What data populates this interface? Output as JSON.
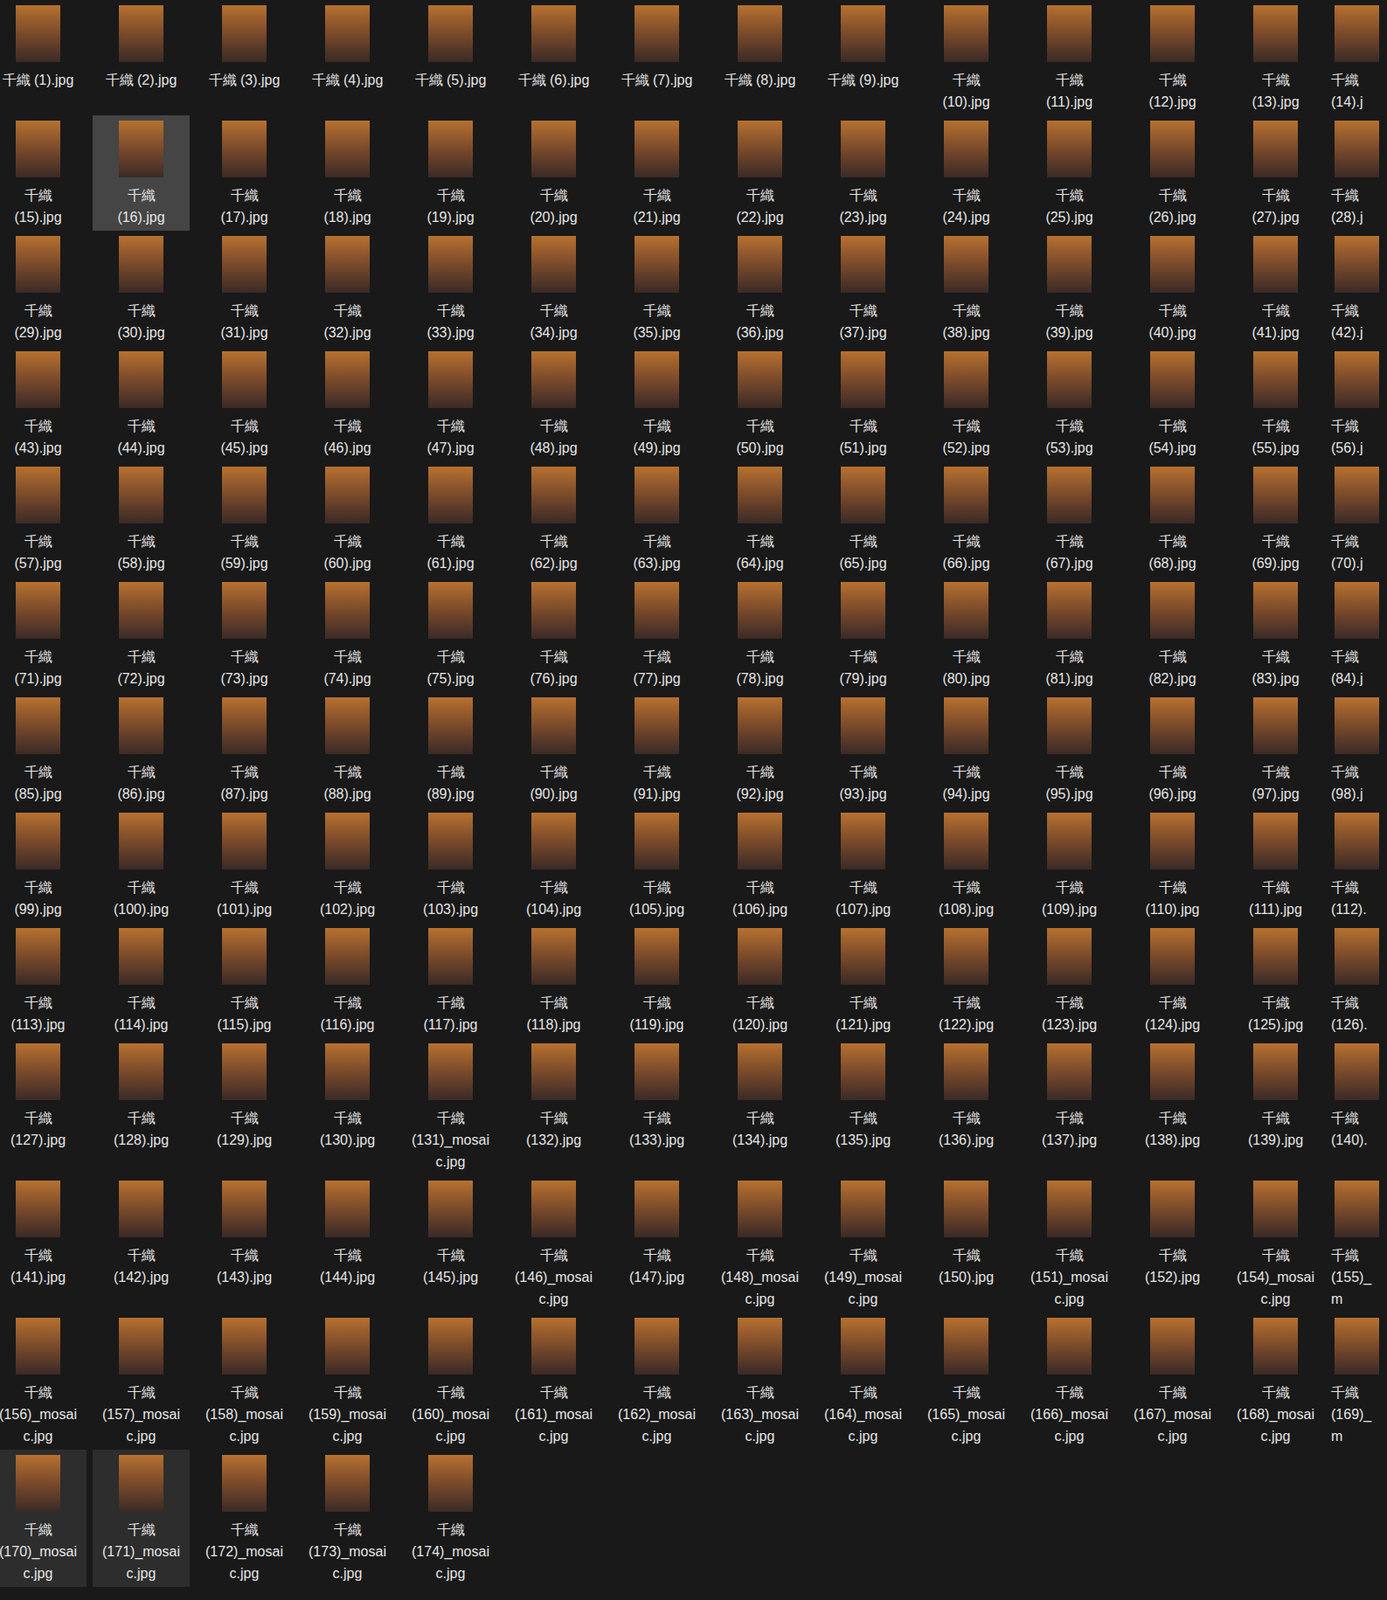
{
  "items": [
    {
      "label": "千織 (1).jpg",
      "selected": false,
      "hovered": false
    },
    {
      "label": "千織 (2).jpg",
      "selected": false,
      "hovered": false
    },
    {
      "label": "千織 (3).jpg",
      "selected": false,
      "hovered": false
    },
    {
      "label": "千織 (4).jpg",
      "selected": false,
      "hovered": false
    },
    {
      "label": "千織 (5).jpg",
      "selected": false,
      "hovered": false
    },
    {
      "label": "千織 (6).jpg",
      "selected": false,
      "hovered": false
    },
    {
      "label": "千織 (7).jpg",
      "selected": false,
      "hovered": false
    },
    {
      "label": "千織 (8).jpg",
      "selected": false,
      "hovered": false
    },
    {
      "label": "千織 (9).jpg",
      "selected": false,
      "hovered": false
    },
    {
      "label": "千織 (10).jpg",
      "selected": false,
      "hovered": false
    },
    {
      "label": "千織 (11).jpg",
      "selected": false,
      "hovered": false
    },
    {
      "label": "千織 (12).jpg",
      "selected": false,
      "hovered": false
    },
    {
      "label": "千織 (13).jpg",
      "selected": false,
      "hovered": false
    },
    {
      "label": "千織 (14).j",
      "selected": false,
      "hovered": false
    },
    {
      "label": "千織 (15).jpg",
      "selected": false,
      "hovered": false
    },
    {
      "label": "千織 (16).jpg",
      "selected": true,
      "hovered": false
    },
    {
      "label": "千織 (17).jpg",
      "selected": false,
      "hovered": false
    },
    {
      "label": "千織 (18).jpg",
      "selected": false,
      "hovered": false
    },
    {
      "label": "千織 (19).jpg",
      "selected": false,
      "hovered": false
    },
    {
      "label": "千織 (20).jpg",
      "selected": false,
      "hovered": false
    },
    {
      "label": "千織 (21).jpg",
      "selected": false,
      "hovered": false
    },
    {
      "label": "千織 (22).jpg",
      "selected": false,
      "hovered": false
    },
    {
      "label": "千織 (23).jpg",
      "selected": false,
      "hovered": false
    },
    {
      "label": "千織 (24).jpg",
      "selected": false,
      "hovered": false
    },
    {
      "label": "千織 (25).jpg",
      "selected": false,
      "hovered": false
    },
    {
      "label": "千織 (26).jpg",
      "selected": false,
      "hovered": false
    },
    {
      "label": "千織 (27).jpg",
      "selected": false,
      "hovered": false
    },
    {
      "label": "千織 (28).j",
      "selected": false,
      "hovered": false
    },
    {
      "label": "千織 (29).jpg",
      "selected": false,
      "hovered": false
    },
    {
      "label": "千織 (30).jpg",
      "selected": false,
      "hovered": false
    },
    {
      "label": "千織 (31).jpg",
      "selected": false,
      "hovered": false
    },
    {
      "label": "千織 (32).jpg",
      "selected": false,
      "hovered": false
    },
    {
      "label": "千織 (33).jpg",
      "selected": false,
      "hovered": false
    },
    {
      "label": "千織 (34).jpg",
      "selected": false,
      "hovered": false
    },
    {
      "label": "千織 (35).jpg",
      "selected": false,
      "hovered": false
    },
    {
      "label": "千織 (36).jpg",
      "selected": false,
      "hovered": false
    },
    {
      "label": "千織 (37).jpg",
      "selected": false,
      "hovered": false
    },
    {
      "label": "千織 (38).jpg",
      "selected": false,
      "hovered": false
    },
    {
      "label": "千織 (39).jpg",
      "selected": false,
      "hovered": false
    },
    {
      "label": "千織 (40).jpg",
      "selected": false,
      "hovered": false
    },
    {
      "label": "千織 (41).jpg",
      "selected": false,
      "hovered": false
    },
    {
      "label": "千織 (42).j",
      "selected": false,
      "hovered": false
    },
    {
      "label": "千織 (43).jpg",
      "selected": false,
      "hovered": false
    },
    {
      "label": "千織 (44).jpg",
      "selected": false,
      "hovered": false
    },
    {
      "label": "千織 (45).jpg",
      "selected": false,
      "hovered": false
    },
    {
      "label": "千織 (46).jpg",
      "selected": false,
      "hovered": false
    },
    {
      "label": "千織 (47).jpg",
      "selected": false,
      "hovered": false
    },
    {
      "label": "千織 (48).jpg",
      "selected": false,
      "hovered": false
    },
    {
      "label": "千織 (49).jpg",
      "selected": false,
      "hovered": false
    },
    {
      "label": "千織 (50).jpg",
      "selected": false,
      "hovered": false
    },
    {
      "label": "千織 (51).jpg",
      "selected": false,
      "hovered": false
    },
    {
      "label": "千織 (52).jpg",
      "selected": false,
      "hovered": false
    },
    {
      "label": "千織 (53).jpg",
      "selected": false,
      "hovered": false
    },
    {
      "label": "千織 (54).jpg",
      "selected": false,
      "hovered": false
    },
    {
      "label": "千織 (55).jpg",
      "selected": false,
      "hovered": false
    },
    {
      "label": "千織 (56).j",
      "selected": false,
      "hovered": false
    },
    {
      "label": "千織 (57).jpg",
      "selected": false,
      "hovered": false
    },
    {
      "label": "千織 (58).jpg",
      "selected": false,
      "hovered": false
    },
    {
      "label": "千織 (59).jpg",
      "selected": false,
      "hovered": false
    },
    {
      "label": "千織 (60).jpg",
      "selected": false,
      "hovered": false
    },
    {
      "label": "千織 (61).jpg",
      "selected": false,
      "hovered": false
    },
    {
      "label": "千織 (62).jpg",
      "selected": false,
      "hovered": false
    },
    {
      "label": "千織 (63).jpg",
      "selected": false,
      "hovered": false
    },
    {
      "label": "千織 (64).jpg",
      "selected": false,
      "hovered": false
    },
    {
      "label": "千織 (65).jpg",
      "selected": false,
      "hovered": false
    },
    {
      "label": "千織 (66).jpg",
      "selected": false,
      "hovered": false
    },
    {
      "label": "千織 (67).jpg",
      "selected": false,
      "hovered": false
    },
    {
      "label": "千織 (68).jpg",
      "selected": false,
      "hovered": false
    },
    {
      "label": "千織 (69).jpg",
      "selected": false,
      "hovered": false
    },
    {
      "label": "千織 (70).j",
      "selected": false,
      "hovered": false
    },
    {
      "label": "千織 (71).jpg",
      "selected": false,
      "hovered": false
    },
    {
      "label": "千織 (72).jpg",
      "selected": false,
      "hovered": false
    },
    {
      "label": "千織 (73).jpg",
      "selected": false,
      "hovered": false
    },
    {
      "label": "千織 (74).jpg",
      "selected": false,
      "hovered": false
    },
    {
      "label": "千織 (75).jpg",
      "selected": false,
      "hovered": false
    },
    {
      "label": "千織 (76).jpg",
      "selected": false,
      "hovered": false
    },
    {
      "label": "千織 (77).jpg",
      "selected": false,
      "hovered": false
    },
    {
      "label": "千織 (78).jpg",
      "selected": false,
      "hovered": false
    },
    {
      "label": "千織 (79).jpg",
      "selected": false,
      "hovered": false
    },
    {
      "label": "千織 (80).jpg",
      "selected": false,
      "hovered": false
    },
    {
      "label": "千織 (81).jpg",
      "selected": false,
      "hovered": false
    },
    {
      "label": "千織 (82).jpg",
      "selected": false,
      "hovered": false
    },
    {
      "label": "千織 (83).jpg",
      "selected": false,
      "hovered": false
    },
    {
      "label": "千織 (84).j",
      "selected": false,
      "hovered": false
    },
    {
      "label": "千織 (85).jpg",
      "selected": false,
      "hovered": false
    },
    {
      "label": "千織 (86).jpg",
      "selected": false,
      "hovered": false
    },
    {
      "label": "千織 (87).jpg",
      "selected": false,
      "hovered": false
    },
    {
      "label": "千織 (88).jpg",
      "selected": false,
      "hovered": false
    },
    {
      "label": "千織 (89).jpg",
      "selected": false,
      "hovered": false
    },
    {
      "label": "千織 (90).jpg",
      "selected": false,
      "hovered": false
    },
    {
      "label": "千織 (91).jpg",
      "selected": false,
      "hovered": false
    },
    {
      "label": "千織 (92).jpg",
      "selected": false,
      "hovered": false
    },
    {
      "label": "千織 (93).jpg",
      "selected": false,
      "hovered": false
    },
    {
      "label": "千織 (94).jpg",
      "selected": false,
      "hovered": false
    },
    {
      "label": "千織 (95).jpg",
      "selected": false,
      "hovered": false
    },
    {
      "label": "千織 (96).jpg",
      "selected": false,
      "hovered": false
    },
    {
      "label": "千織 (97).jpg",
      "selected": false,
      "hovered": false
    },
    {
      "label": "千織 (98).j",
      "selected": false,
      "hovered": false
    },
    {
      "label": "千織 (99).jpg",
      "selected": false,
      "hovered": false
    },
    {
      "label": "千織 (100).jpg",
      "selected": false,
      "hovered": false
    },
    {
      "label": "千織 (101).jpg",
      "selected": false,
      "hovered": false
    },
    {
      "label": "千織 (102).jpg",
      "selected": false,
      "hovered": false
    },
    {
      "label": "千織 (103).jpg",
      "selected": false,
      "hovered": false
    },
    {
      "label": "千織 (104).jpg",
      "selected": false,
      "hovered": false
    },
    {
      "label": "千織 (105).jpg",
      "selected": false,
      "hovered": false
    },
    {
      "label": "千織 (106).jpg",
      "selected": false,
      "hovered": false
    },
    {
      "label": "千織 (107).jpg",
      "selected": false,
      "hovered": false
    },
    {
      "label": "千織 (108).jpg",
      "selected": false,
      "hovered": false
    },
    {
      "label": "千織 (109).jpg",
      "selected": false,
      "hovered": false
    },
    {
      "label": "千織 (110).jpg",
      "selected": false,
      "hovered": false
    },
    {
      "label": "千織 (111).jpg",
      "selected": false,
      "hovered": false
    },
    {
      "label": "千織 (112).",
      "selected": false,
      "hovered": false
    },
    {
      "label": "千織 (113).jpg",
      "selected": false,
      "hovered": false
    },
    {
      "label": "千織 (114).jpg",
      "selected": false,
      "hovered": false
    },
    {
      "label": "千織 (115).jpg",
      "selected": false,
      "hovered": false
    },
    {
      "label": "千織 (116).jpg",
      "selected": false,
      "hovered": false
    },
    {
      "label": "千織 (117).jpg",
      "selected": false,
      "hovered": false
    },
    {
      "label": "千織 (118).jpg",
      "selected": false,
      "hovered": false
    },
    {
      "label": "千織 (119).jpg",
      "selected": false,
      "hovered": false
    },
    {
      "label": "千織 (120).jpg",
      "selected": false,
      "hovered": false
    },
    {
      "label": "千織 (121).jpg",
      "selected": false,
      "hovered": false
    },
    {
      "label": "千織 (122).jpg",
      "selected": false,
      "hovered": false
    },
    {
      "label": "千織 (123).jpg",
      "selected": false,
      "hovered": false
    },
    {
      "label": "千織 (124).jpg",
      "selected": false,
      "hovered": false
    },
    {
      "label": "千織 (125).jpg",
      "selected": false,
      "hovered": false
    },
    {
      "label": "千織 (126).",
      "selected": false,
      "hovered": false
    },
    {
      "label": "千織 (127).jpg",
      "selected": false,
      "hovered": false
    },
    {
      "label": "千織 (128).jpg",
      "selected": false,
      "hovered": false
    },
    {
      "label": "千織 (129).jpg",
      "selected": false,
      "hovered": false
    },
    {
      "label": "千織 (130).jpg",
      "selected": false,
      "hovered": false
    },
    {
      "label": "千織 (131)_mosaic.jpg",
      "selected": false,
      "hovered": false
    },
    {
      "label": "千織 (132).jpg",
      "selected": false,
      "hovered": false
    },
    {
      "label": "千織 (133).jpg",
      "selected": false,
      "hovered": false
    },
    {
      "label": "千織 (134).jpg",
      "selected": false,
      "hovered": false
    },
    {
      "label": "千織 (135).jpg",
      "selected": false,
      "hovered": false
    },
    {
      "label": "千織 (136).jpg",
      "selected": false,
      "hovered": false
    },
    {
      "label": "千織 (137).jpg",
      "selected": false,
      "hovered": false
    },
    {
      "label": "千織 (138).jpg",
      "selected": false,
      "hovered": false
    },
    {
      "label": "千織 (139).jpg",
      "selected": false,
      "hovered": false
    },
    {
      "label": "千織 (140).",
      "selected": false,
      "hovered": false
    },
    {
      "label": "千織 (141).jpg",
      "selected": false,
      "hovered": false
    },
    {
      "label": "千織 (142).jpg",
      "selected": false,
      "hovered": false
    },
    {
      "label": "千織 (143).jpg",
      "selected": false,
      "hovered": false
    },
    {
      "label": "千織 (144).jpg",
      "selected": false,
      "hovered": false
    },
    {
      "label": "千織 (145).jpg",
      "selected": false,
      "hovered": false
    },
    {
      "label": "千織 (146)_mosaic.jpg",
      "selected": false,
      "hovered": false
    },
    {
      "label": "千織 (147).jpg",
      "selected": false,
      "hovered": false
    },
    {
      "label": "千織 (148)_mosaic.jpg",
      "selected": false,
      "hovered": false
    },
    {
      "label": "千織 (149)_mosaic.jpg",
      "selected": false,
      "hovered": false
    },
    {
      "label": "千織 (150).jpg",
      "selected": false,
      "hovered": false
    },
    {
      "label": "千織 (151)_mosaic.jpg",
      "selected": false,
      "hovered": false
    },
    {
      "label": "千織 (152).jpg",
      "selected": false,
      "hovered": false
    },
    {
      "label": "千織 (154)_mosaic.jpg",
      "selected": false,
      "hovered": false
    },
    {
      "label": "千織 (155)_m",
      "selected": false,
      "hovered": false
    },
    {
      "label": "千織 (156)_mosaic.jpg",
      "selected": false,
      "hovered": false
    },
    {
      "label": "千織 (157)_mosaic.jpg",
      "selected": false,
      "hovered": false
    },
    {
      "label": "千織 (158)_mosaic.jpg",
      "selected": false,
      "hovered": false
    },
    {
      "label": "千織 (159)_mosaic.jpg",
      "selected": false,
      "hovered": false
    },
    {
      "label": "千織 (160)_mosaic.jpg",
      "selected": false,
      "hovered": false
    },
    {
      "label": "千織 (161)_mosaic.jpg",
      "selected": false,
      "hovered": false
    },
    {
      "label": "千織 (162)_mosaic.jpg",
      "selected": false,
      "hovered": false
    },
    {
      "label": "千織 (163)_mosaic.jpg",
      "selected": false,
      "hovered": false
    },
    {
      "label": "千織 (164)_mosaic.jpg",
      "selected": false,
      "hovered": false
    },
    {
      "label": "千織 (165)_mosaic.jpg",
      "selected": false,
      "hovered": false
    },
    {
      "label": "千織 (166)_mosaic.jpg",
      "selected": false,
      "hovered": false
    },
    {
      "label": "千織 (167)_mosaic.jpg",
      "selected": false,
      "hovered": false
    },
    {
      "label": "千織 (168)_mosaic.jpg",
      "selected": false,
      "hovered": false
    },
    {
      "label": "千織 (169)_m",
      "selected": false,
      "hovered": false
    },
    {
      "label": "千織 (170)_mosaic.jpg",
      "selected": false,
      "hovered": true
    },
    {
      "label": "千織 (171)_mosaic.jpg",
      "selected": false,
      "hovered": true
    },
    {
      "label": "千織 (172)_mosaic.jpg",
      "selected": false,
      "hovered": false
    },
    {
      "label": "千織 (173)_mosaic.jpg",
      "selected": false,
      "hovered": false
    },
    {
      "label": "千織 (174)_mosaic.jpg",
      "selected": false,
      "hovered": false
    }
  ]
}
